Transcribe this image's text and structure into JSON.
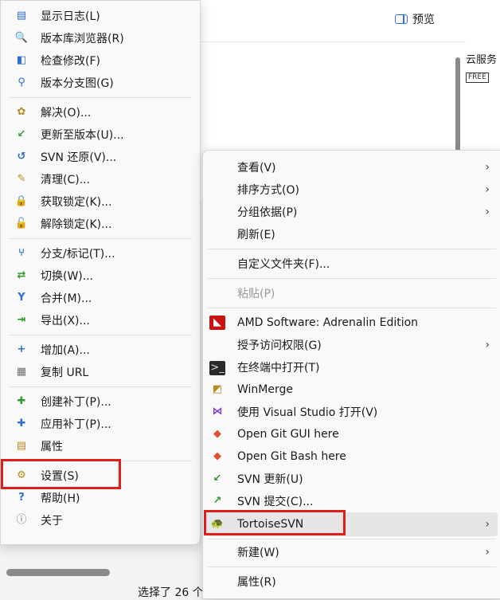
{
  "explorer": {
    "preview_label": "预览",
    "cloud_text": "云服务",
    "free_badge": "FREE",
    "status_text": "选择了 26 个"
  },
  "svn_menu": {
    "items": [
      {
        "label": "显示日志(L)",
        "icon": "log-icon"
      },
      {
        "label": "版本库浏览器(R)",
        "icon": "repo-browser-icon"
      },
      {
        "label": "检查修改(F)",
        "icon": "check-modifications-icon"
      },
      {
        "label": "版本分支图(G)",
        "icon": "revision-graph-icon"
      },
      {
        "label": "解决(O)...",
        "icon": "resolve-icon"
      },
      {
        "label": "更新至版本(U)...",
        "icon": "update-to-revision-icon"
      },
      {
        "label": "SVN 还原(V)...",
        "icon": "revert-icon"
      },
      {
        "label": "清理(C)...",
        "icon": "cleanup-icon"
      },
      {
        "label": "获取锁定(K)...",
        "icon": "lock-icon"
      },
      {
        "label": "解除锁定(K)...",
        "icon": "unlock-icon"
      },
      {
        "label": "分支/标记(T)...",
        "icon": "branch-icon"
      },
      {
        "label": "切换(W)...",
        "icon": "switch-icon"
      },
      {
        "label": "合并(M)...",
        "icon": "merge-icon"
      },
      {
        "label": "导出(X)...",
        "icon": "export-icon"
      },
      {
        "label": "增加(A)...",
        "icon": "add-icon"
      },
      {
        "label": "复制 URL",
        "icon": "copy-url-icon"
      },
      {
        "label": "创建补丁(P)...",
        "icon": "create-patch-icon"
      },
      {
        "label": "应用补丁(P)...",
        "icon": "apply-patch-icon"
      },
      {
        "label": "属性",
        "icon": "properties-icon"
      },
      {
        "label": "设置(S)",
        "icon": "settings-icon"
      },
      {
        "label": "帮助(H)",
        "icon": "help-icon"
      },
      {
        "label": "关于",
        "icon": "about-icon"
      }
    ]
  },
  "context_menu": {
    "items": [
      {
        "label": "查看(V)",
        "submenu": true
      },
      {
        "label": "排序方式(O)",
        "submenu": true
      },
      {
        "label": "分组依据(P)",
        "submenu": true
      },
      {
        "label": "刷新(E)"
      },
      {
        "label": "自定义文件夹(F)..."
      },
      {
        "label": "粘贴(P)",
        "disabled": true
      },
      {
        "label": "AMD Software: Adrenalin Edition",
        "icon": "amd-icon"
      },
      {
        "label": "授予访问权限(G)",
        "submenu": true
      },
      {
        "label": "在终端中打开(T)",
        "icon": "terminal-icon"
      },
      {
        "label": "WinMerge",
        "icon": "winmerge-icon"
      },
      {
        "label": "使用 Visual Studio 打开(V)",
        "icon": "visual-studio-icon"
      },
      {
        "label": "Open Git GUI here",
        "icon": "git-gui-icon"
      },
      {
        "label": "Open Git Bash here",
        "icon": "git-bash-icon"
      },
      {
        "label": "SVN 更新(U)",
        "icon": "svn-update-icon"
      },
      {
        "label": "SVN 提交(C)...",
        "icon": "svn-commit-icon"
      },
      {
        "label": "TortoiseSVN",
        "icon": "tortoisesvn-icon",
        "submenu": true
      },
      {
        "label": "新建(W)",
        "submenu": true
      },
      {
        "label": "属性(R)"
      }
    ]
  },
  "symbols": {
    "submenu_arrow": "›"
  },
  "highlight_color": "#e01d1d"
}
